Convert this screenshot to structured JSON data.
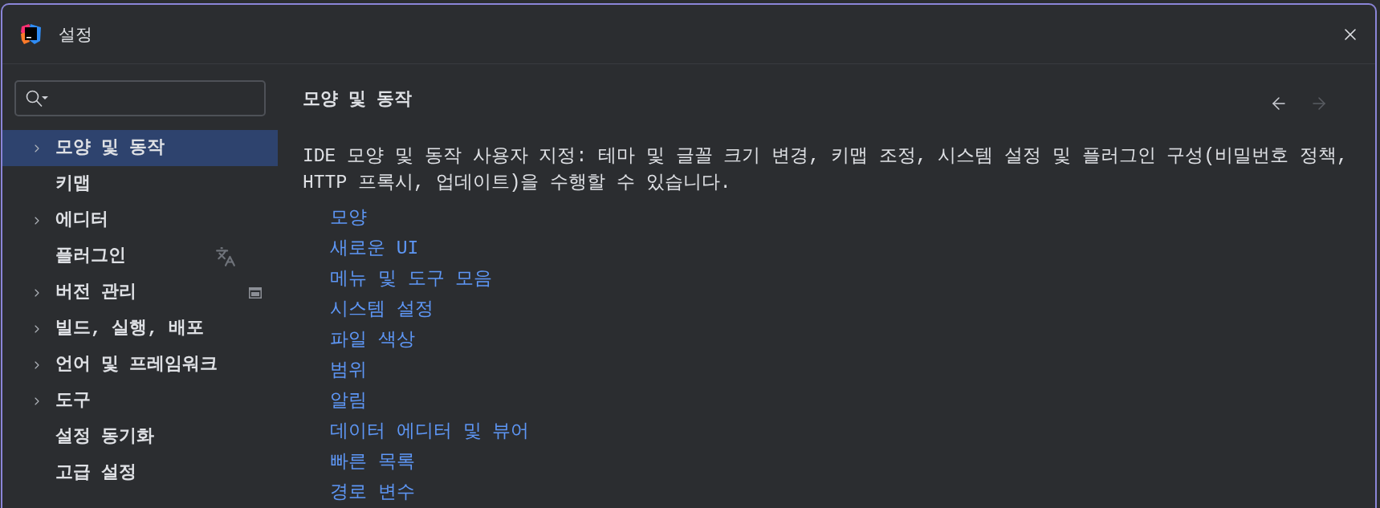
{
  "window": {
    "title": "설정"
  },
  "sidebar": {
    "items": [
      {
        "label": "모양 및 동작",
        "expandable": true,
        "selected": true,
        "translation_marker": false,
        "project_level": false
      },
      {
        "label": "키맵",
        "expandable": false,
        "selected": false,
        "translation_marker": false,
        "project_level": false
      },
      {
        "label": "에디터",
        "expandable": true,
        "selected": false,
        "translation_marker": false,
        "project_level": false
      },
      {
        "label": "플러그인",
        "expandable": false,
        "selected": false,
        "translation_marker": true,
        "project_level": false
      },
      {
        "label": "버전 관리",
        "expandable": true,
        "selected": false,
        "translation_marker": false,
        "project_level": true
      },
      {
        "label": "빌드, 실행, 배포",
        "expandable": true,
        "selected": false,
        "translation_marker": false,
        "project_level": false
      },
      {
        "label": "언어 및 프레임워크",
        "expandable": true,
        "selected": false,
        "translation_marker": false,
        "project_level": false
      },
      {
        "label": "도구",
        "expandable": true,
        "selected": false,
        "translation_marker": false,
        "project_level": false
      },
      {
        "label": "설정 동기화",
        "expandable": false,
        "selected": false,
        "translation_marker": false,
        "project_level": false
      },
      {
        "label": "고급 설정",
        "expandable": false,
        "selected": false,
        "translation_marker": false,
        "project_level": false
      }
    ]
  },
  "navigation": {
    "back_enabled": true,
    "forward_enabled": false
  },
  "content": {
    "title": "모양 및 동작",
    "description": "IDE 모양 및 동작 사용자 지정: 테마 및 글꼴 크기 변경, 키맵 조정, 시스템 설정 및 플러그인 구성(비밀번호 정책, HTTP 프록시, 업데이트)을 수행할 수 있습니다.",
    "links": [
      "모양",
      "새로운 UI",
      "메뉴 및 도구 모음",
      "시스템 설정",
      "파일 색상",
      "범위",
      "알림",
      "데이터 에디터 및 뷰어",
      "빠른 목록",
      "경로 변수"
    ]
  }
}
